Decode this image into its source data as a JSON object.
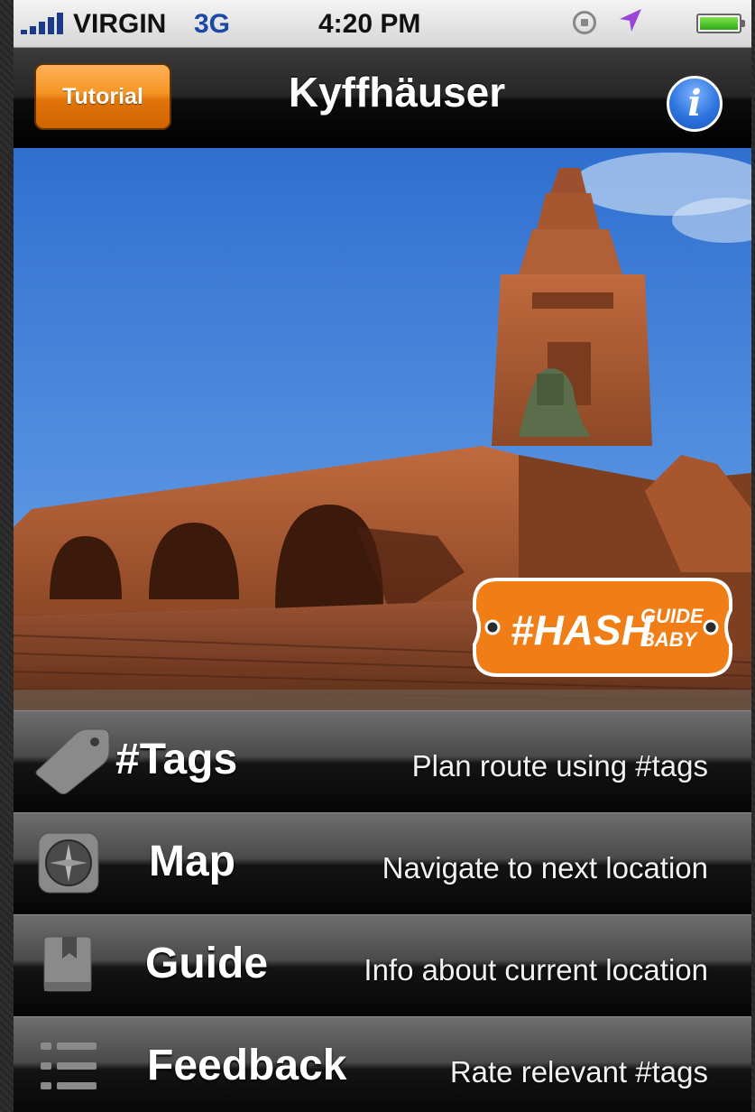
{
  "status_bar": {
    "carrier": "VIRGIN",
    "network": "3G",
    "time": "4:20 PM"
  },
  "nav_bar": {
    "tutorial_label": "Tutorial",
    "title": "Kyffhäuser",
    "info_label": "i"
  },
  "hero": {
    "badge_hash": "#HASH",
    "badge_guide": "GUIDE",
    "badge_baby": "BABY"
  },
  "menu": {
    "items": [
      {
        "label": "#Tags",
        "description": "Plan route using #tags",
        "icon": "tag-icon"
      },
      {
        "label": "Map",
        "description": "Navigate to next location",
        "icon": "compass-icon"
      },
      {
        "label": "Guide",
        "description": "Info about current location",
        "icon": "book-icon"
      },
      {
        "label": "Feedback",
        "description": "Rate relevant #tags",
        "icon": "list-icon"
      }
    ]
  },
  "colors": {
    "tutorial_orange": "#f08a1c",
    "badge_orange": "#f07d16",
    "info_blue": "#2e74e0",
    "sky_blue": "#3f7fd8"
  }
}
